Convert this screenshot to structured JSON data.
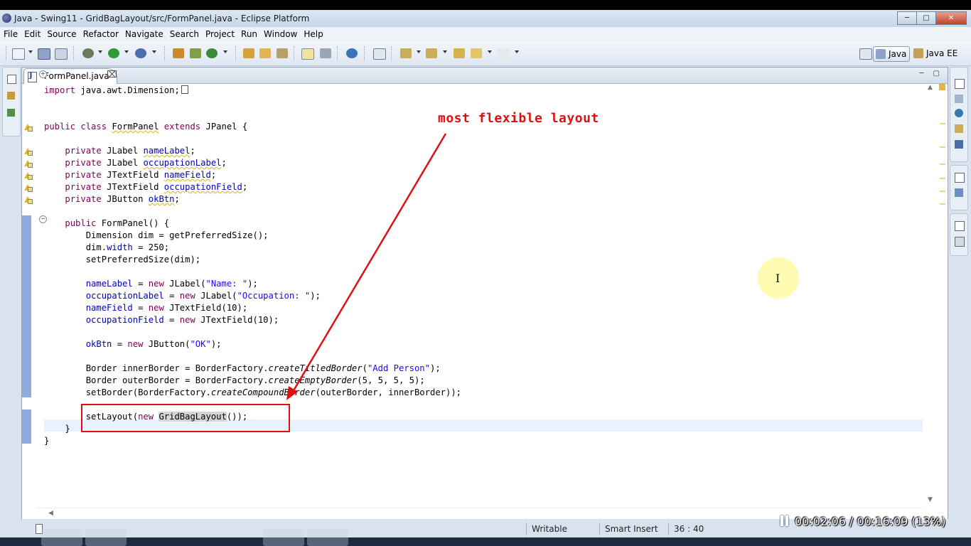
{
  "window": {
    "title": "Java - Swing11 - GridBagLayout/src/FormPanel.java - Eclipse Platform",
    "controls": [
      "minimize-icon",
      "maximize-icon",
      "close-icon"
    ]
  },
  "menu": [
    "File",
    "Edit",
    "Source",
    "Refactor",
    "Navigate",
    "Search",
    "Project",
    "Run",
    "Window",
    "Help"
  ],
  "perspectives": {
    "java": "Java",
    "java_ee": "Java EE"
  },
  "editor": {
    "tab_label": "*FormPanel.java",
    "lines": [
      [
        {
          "t": "import",
          "c": "kw"
        },
        {
          "t": " java.awt.Dimension;"
        }
      ],
      [],
      [],
      [
        {
          "t": "public class ",
          "c": "kw"
        },
        {
          "t": "FormPanel",
          "c": "warn"
        },
        {
          "t": " "
        },
        {
          "t": "extends",
          "c": "kw"
        },
        {
          "t": " JPanel {"
        }
      ],
      [],
      [
        {
          "t": "    "
        },
        {
          "t": "private",
          "c": "kw"
        },
        {
          "t": " JLabel "
        },
        {
          "t": "nameLabel",
          "c": "fld warn"
        },
        {
          "t": ";"
        }
      ],
      [
        {
          "t": "    "
        },
        {
          "t": "private",
          "c": "kw"
        },
        {
          "t": " JLabel "
        },
        {
          "t": "occupationLabel",
          "c": "fld warn"
        },
        {
          "t": ";"
        }
      ],
      [
        {
          "t": "    "
        },
        {
          "t": "private",
          "c": "kw"
        },
        {
          "t": " JTextField "
        },
        {
          "t": "nameField",
          "c": "fld warn"
        },
        {
          "t": ";"
        }
      ],
      [
        {
          "t": "    "
        },
        {
          "t": "private",
          "c": "kw"
        },
        {
          "t": " JTextField "
        },
        {
          "t": "occupationField",
          "c": "fld warn"
        },
        {
          "t": ";"
        }
      ],
      [
        {
          "t": "    "
        },
        {
          "t": "private",
          "c": "kw"
        },
        {
          "t": " JButton "
        },
        {
          "t": "okBtn",
          "c": "fld warn"
        },
        {
          "t": ";"
        }
      ],
      [],
      [
        {
          "t": "    "
        },
        {
          "t": "public",
          "c": "kw"
        },
        {
          "t": " FormPanel() {"
        }
      ],
      [
        {
          "t": "        Dimension dim = getPreferredSize();"
        }
      ],
      [
        {
          "t": "        dim."
        },
        {
          "t": "width",
          "c": "fld"
        },
        {
          "t": " = 250;"
        }
      ],
      [
        {
          "t": "        setPreferredSize(dim);"
        }
      ],
      [],
      [
        {
          "t": "        "
        },
        {
          "t": "nameLabel",
          "c": "fld"
        },
        {
          "t": " = "
        },
        {
          "t": "new",
          "c": "kw"
        },
        {
          "t": " JLabel("
        },
        {
          "t": "\"Name: \"",
          "c": "str"
        },
        {
          "t": ");"
        }
      ],
      [
        {
          "t": "        "
        },
        {
          "t": "occupationLabel",
          "c": "fld"
        },
        {
          "t": " = "
        },
        {
          "t": "new",
          "c": "kw"
        },
        {
          "t": " JLabel("
        },
        {
          "t": "\"Occupation: \"",
          "c": "str"
        },
        {
          "t": ");"
        }
      ],
      [
        {
          "t": "        "
        },
        {
          "t": "nameField",
          "c": "fld"
        },
        {
          "t": " = "
        },
        {
          "t": "new",
          "c": "kw"
        },
        {
          "t": " JTextField(10);"
        }
      ],
      [
        {
          "t": "        "
        },
        {
          "t": "occupationField",
          "c": "fld"
        },
        {
          "t": " = "
        },
        {
          "t": "new",
          "c": "kw"
        },
        {
          "t": " JTextField(10);"
        }
      ],
      [],
      [
        {
          "t": "        "
        },
        {
          "t": "okBtn",
          "c": "fld"
        },
        {
          "t": " = "
        },
        {
          "t": "new",
          "c": "kw"
        },
        {
          "t": " JButton("
        },
        {
          "t": "\"OK\"",
          "c": "str"
        },
        {
          "t": ");"
        }
      ],
      [],
      [
        {
          "t": "        Border innerBorder = BorderFactory."
        },
        {
          "t": "createTitledBorder",
          "c": "it"
        },
        {
          "t": "("
        },
        {
          "t": "\"Add Person\"",
          "c": "str"
        },
        {
          "t": ");"
        }
      ],
      [
        {
          "t": "        Border outerBorder = BorderFactory."
        },
        {
          "t": "createEmptyBorder",
          "c": "it"
        },
        {
          "t": "(5, 5, 5, 5);"
        }
      ],
      [
        {
          "t": "        setBorder(BorderFactory."
        },
        {
          "t": "createCompoundBorder",
          "c": "it"
        },
        {
          "t": "(outerBorder, innerBorder));"
        }
      ],
      [],
      [
        {
          "t": "        setLayout("
        },
        {
          "t": "new",
          "c": "kw"
        },
        {
          "t": " "
        },
        {
          "t": "GridBagLayout",
          "c": "hl"
        },
        {
          "t": "());"
        }
      ],
      [
        {
          "t": "    }"
        }
      ],
      [
        {
          "t": "}"
        }
      ]
    ]
  },
  "annotation": {
    "text": "most flexible layout",
    "color": "#e01010"
  },
  "status": {
    "writable": "Writable",
    "insert_mode": "Smart Insert",
    "position": "36 : 40"
  },
  "player": {
    "elapsed": "00:02:06",
    "separator": "/",
    "total": "00:16:09",
    "percent": "(13%)"
  },
  "colors": {
    "keyword": "#7f0055",
    "field": "#0000c0",
    "string": "#2a00ff",
    "current_line": "#e8f2fe",
    "annotation": "#e01010"
  }
}
